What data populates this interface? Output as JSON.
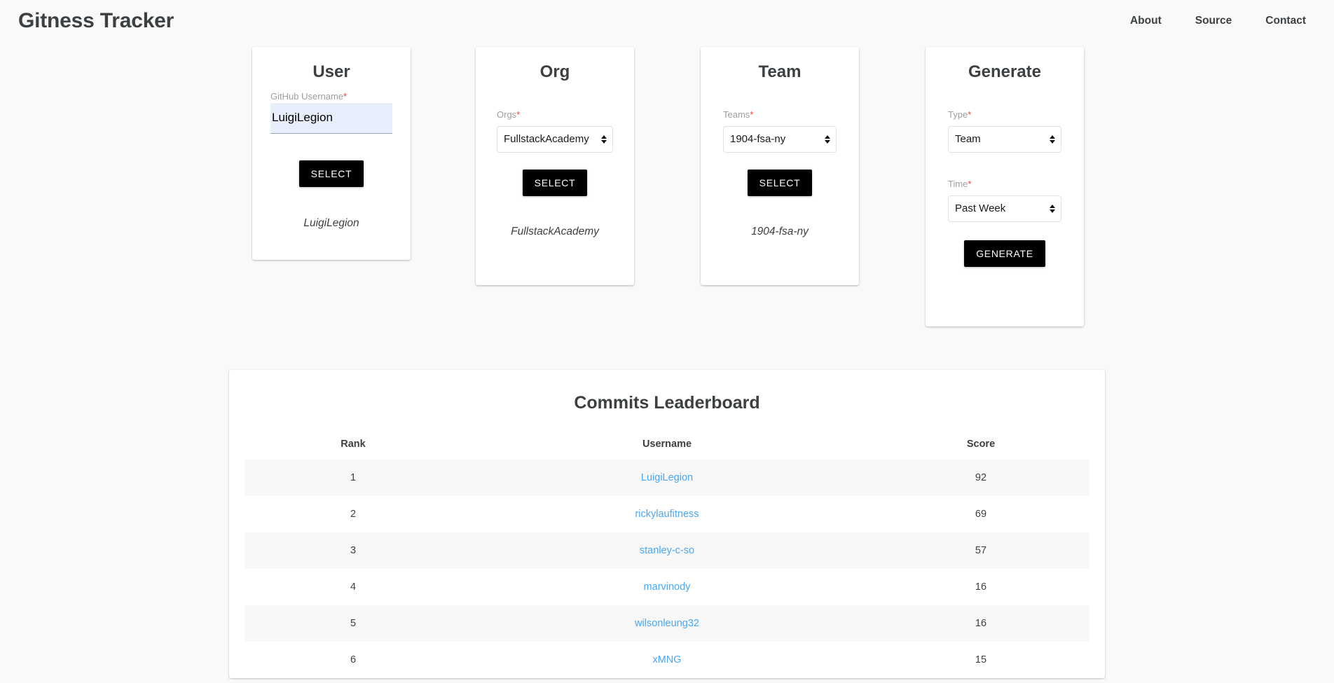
{
  "header": {
    "brand": "Gitness Tracker",
    "nav": [
      {
        "label": "About"
      },
      {
        "label": "Source"
      },
      {
        "label": "Contact"
      }
    ]
  },
  "cards": {
    "user": {
      "title": "User",
      "label": "GitHub Username",
      "required_mark": "*",
      "input_value": "LuigiLegion",
      "input_placeholder": "",
      "button": "SELECT",
      "result": "LuigiLegion"
    },
    "org": {
      "title": "Org",
      "label": "Orgs",
      "required_mark": "*",
      "selected": "FullstackAcademy",
      "button": "SELECT",
      "result": "FullstackAcademy"
    },
    "team": {
      "title": "Team",
      "label": "Teams",
      "required_mark": "*",
      "selected": "1904-fsa-ny",
      "button": "SELECT",
      "result": "1904-fsa-ny"
    },
    "generate": {
      "title": "Generate",
      "type_label": "Type",
      "type_required_mark": "*",
      "type_selected": "Team",
      "time_label": "Time",
      "time_required_mark": "*",
      "time_selected": "Past Week",
      "button": "GENERATE"
    }
  },
  "leaderboard": {
    "title": "Commits Leaderboard",
    "columns": [
      "Rank",
      "Username",
      "Score"
    ],
    "rows": [
      {
        "rank": "1",
        "username": "LuigiLegion",
        "score": "92"
      },
      {
        "rank": "2",
        "username": "rickylaufitness",
        "score": "69"
      },
      {
        "rank": "3",
        "username": "stanley-c-so",
        "score": "57"
      },
      {
        "rank": "4",
        "username": "marvinody",
        "score": "16"
      },
      {
        "rank": "5",
        "username": "wilsonleung32",
        "score": "16"
      },
      {
        "rank": "6",
        "username": "xMNG",
        "score": "15"
      }
    ]
  },
  "colors": {
    "page_background": "#f9f9f9",
    "card_background": "#ffffff",
    "text_primary": "#3c4043",
    "label_gray": "#9e9e9e",
    "required_red": "#f44336",
    "button_black": "#000000",
    "link_blue": "#49a7f5",
    "input_fill": "#e8eefb",
    "row_stripe": "#f7f7f7"
  }
}
